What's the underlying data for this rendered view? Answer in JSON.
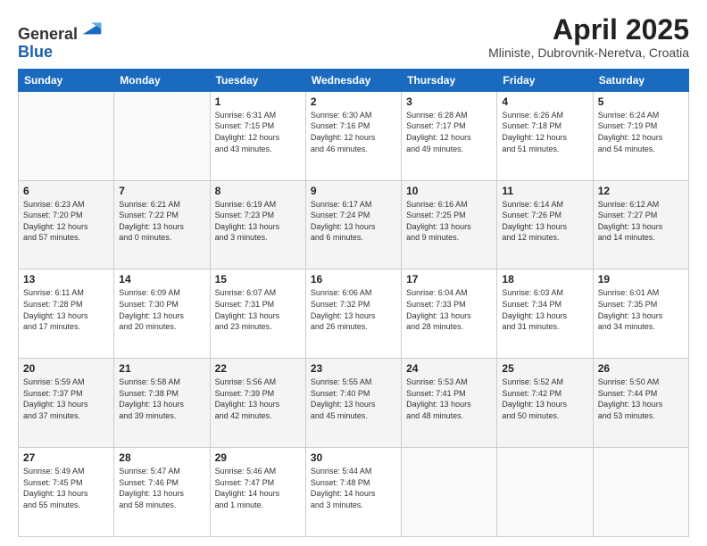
{
  "header": {
    "logo_line1": "General",
    "logo_line2": "Blue",
    "title": "April 2025",
    "location": "Mliniste, Dubrovnik-Neretva, Croatia"
  },
  "days_of_week": [
    "Sunday",
    "Monday",
    "Tuesday",
    "Wednesday",
    "Thursday",
    "Friday",
    "Saturday"
  ],
  "weeks": [
    [
      {
        "day": "",
        "info": ""
      },
      {
        "day": "",
        "info": ""
      },
      {
        "day": "1",
        "info": "Sunrise: 6:31 AM\nSunset: 7:15 PM\nDaylight: 12 hours\nand 43 minutes."
      },
      {
        "day": "2",
        "info": "Sunrise: 6:30 AM\nSunset: 7:16 PM\nDaylight: 12 hours\nand 46 minutes."
      },
      {
        "day": "3",
        "info": "Sunrise: 6:28 AM\nSunset: 7:17 PM\nDaylight: 12 hours\nand 49 minutes."
      },
      {
        "day": "4",
        "info": "Sunrise: 6:26 AM\nSunset: 7:18 PM\nDaylight: 12 hours\nand 51 minutes."
      },
      {
        "day": "5",
        "info": "Sunrise: 6:24 AM\nSunset: 7:19 PM\nDaylight: 12 hours\nand 54 minutes."
      }
    ],
    [
      {
        "day": "6",
        "info": "Sunrise: 6:23 AM\nSunset: 7:20 PM\nDaylight: 12 hours\nand 57 minutes."
      },
      {
        "day": "7",
        "info": "Sunrise: 6:21 AM\nSunset: 7:22 PM\nDaylight: 13 hours\nand 0 minutes."
      },
      {
        "day": "8",
        "info": "Sunrise: 6:19 AM\nSunset: 7:23 PM\nDaylight: 13 hours\nand 3 minutes."
      },
      {
        "day": "9",
        "info": "Sunrise: 6:17 AM\nSunset: 7:24 PM\nDaylight: 13 hours\nand 6 minutes."
      },
      {
        "day": "10",
        "info": "Sunrise: 6:16 AM\nSunset: 7:25 PM\nDaylight: 13 hours\nand 9 minutes."
      },
      {
        "day": "11",
        "info": "Sunrise: 6:14 AM\nSunset: 7:26 PM\nDaylight: 13 hours\nand 12 minutes."
      },
      {
        "day": "12",
        "info": "Sunrise: 6:12 AM\nSunset: 7:27 PM\nDaylight: 13 hours\nand 14 minutes."
      }
    ],
    [
      {
        "day": "13",
        "info": "Sunrise: 6:11 AM\nSunset: 7:28 PM\nDaylight: 13 hours\nand 17 minutes."
      },
      {
        "day": "14",
        "info": "Sunrise: 6:09 AM\nSunset: 7:30 PM\nDaylight: 13 hours\nand 20 minutes."
      },
      {
        "day": "15",
        "info": "Sunrise: 6:07 AM\nSunset: 7:31 PM\nDaylight: 13 hours\nand 23 minutes."
      },
      {
        "day": "16",
        "info": "Sunrise: 6:06 AM\nSunset: 7:32 PM\nDaylight: 13 hours\nand 26 minutes."
      },
      {
        "day": "17",
        "info": "Sunrise: 6:04 AM\nSunset: 7:33 PM\nDaylight: 13 hours\nand 28 minutes."
      },
      {
        "day": "18",
        "info": "Sunrise: 6:03 AM\nSunset: 7:34 PM\nDaylight: 13 hours\nand 31 minutes."
      },
      {
        "day": "19",
        "info": "Sunrise: 6:01 AM\nSunset: 7:35 PM\nDaylight: 13 hours\nand 34 minutes."
      }
    ],
    [
      {
        "day": "20",
        "info": "Sunrise: 5:59 AM\nSunset: 7:37 PM\nDaylight: 13 hours\nand 37 minutes."
      },
      {
        "day": "21",
        "info": "Sunrise: 5:58 AM\nSunset: 7:38 PM\nDaylight: 13 hours\nand 39 minutes."
      },
      {
        "day": "22",
        "info": "Sunrise: 5:56 AM\nSunset: 7:39 PM\nDaylight: 13 hours\nand 42 minutes."
      },
      {
        "day": "23",
        "info": "Sunrise: 5:55 AM\nSunset: 7:40 PM\nDaylight: 13 hours\nand 45 minutes."
      },
      {
        "day": "24",
        "info": "Sunrise: 5:53 AM\nSunset: 7:41 PM\nDaylight: 13 hours\nand 48 minutes."
      },
      {
        "day": "25",
        "info": "Sunrise: 5:52 AM\nSunset: 7:42 PM\nDaylight: 13 hours\nand 50 minutes."
      },
      {
        "day": "26",
        "info": "Sunrise: 5:50 AM\nSunset: 7:44 PM\nDaylight: 13 hours\nand 53 minutes."
      }
    ],
    [
      {
        "day": "27",
        "info": "Sunrise: 5:49 AM\nSunset: 7:45 PM\nDaylight: 13 hours\nand 55 minutes."
      },
      {
        "day": "28",
        "info": "Sunrise: 5:47 AM\nSunset: 7:46 PM\nDaylight: 13 hours\nand 58 minutes."
      },
      {
        "day": "29",
        "info": "Sunrise: 5:46 AM\nSunset: 7:47 PM\nDaylight: 14 hours\nand 1 minute."
      },
      {
        "day": "30",
        "info": "Sunrise: 5:44 AM\nSunset: 7:48 PM\nDaylight: 14 hours\nand 3 minutes."
      },
      {
        "day": "",
        "info": ""
      },
      {
        "day": "",
        "info": ""
      },
      {
        "day": "",
        "info": ""
      }
    ]
  ]
}
